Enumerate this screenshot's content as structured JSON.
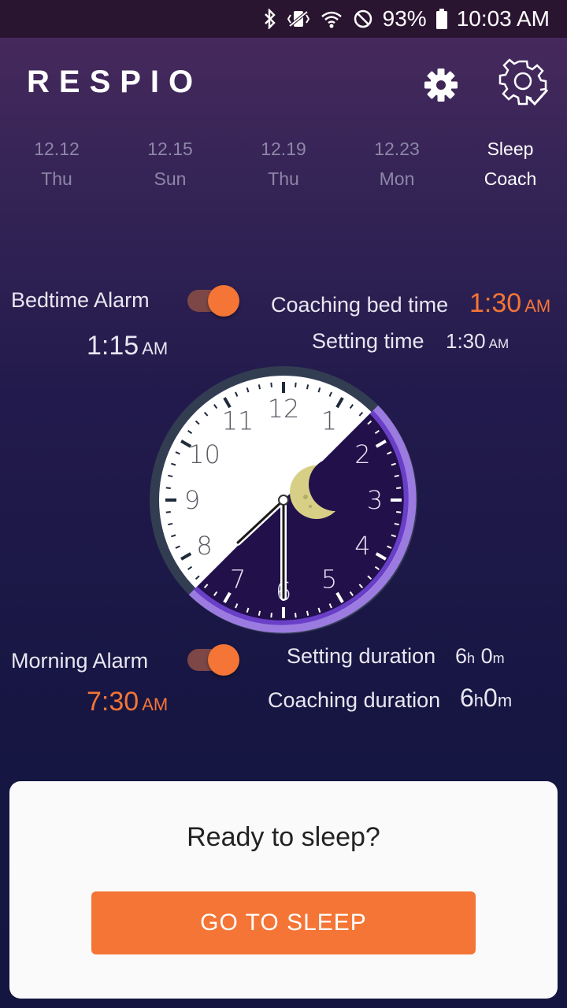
{
  "status_bar": {
    "battery": "93%",
    "time": "10:03 AM",
    "icons": [
      "bluetooth-icon",
      "vibrate-icon",
      "wifi-icon",
      "do-not-disturb-icon",
      "battery-icon"
    ]
  },
  "header": {
    "title": "RESPIO",
    "icons": [
      "settings-icon",
      "coach-settings-icon"
    ]
  },
  "tabs": [
    {
      "date": "12.12",
      "day": "Thu"
    },
    {
      "date": "12.15",
      "day": "Sun"
    },
    {
      "date": "12.19",
      "day": "Thu"
    },
    {
      "date": "12.23",
      "day": "Mon"
    },
    {
      "date": "Sleep",
      "day": "Coach",
      "active": true
    }
  ],
  "bedtime": {
    "label": "Bedtime Alarm",
    "time": "1:15",
    "ampm": "AM",
    "enabled": true
  },
  "coaching_bed": {
    "label": "Coaching bed time",
    "time": "1:30",
    "ampm": "AM"
  },
  "setting_time": {
    "label": "Setting time",
    "time": "1:30",
    "ampm": "AM"
  },
  "clock": {
    "numbers": [
      "12",
      "1",
      "2",
      "3",
      "4",
      "5",
      "6",
      "7",
      "8",
      "9",
      "10",
      "11"
    ]
  },
  "morning": {
    "label": "Morning Alarm",
    "time": "7:30",
    "ampm": "AM",
    "enabled": true
  },
  "setting_duration": {
    "label": "Setting duration",
    "h": "6",
    "h_unit": "h",
    "m": "0",
    "m_unit": "m"
  },
  "coaching_duration": {
    "label": "Coaching duration",
    "h": "6",
    "h_unit": "h",
    "m": "0",
    "m_unit": "m"
  },
  "card": {
    "question": "Ready to sleep?",
    "button": "GO TO SLEEP"
  },
  "colors": {
    "accent": "#f47535",
    "arc": "#9b7be0",
    "night": "#21104a"
  }
}
